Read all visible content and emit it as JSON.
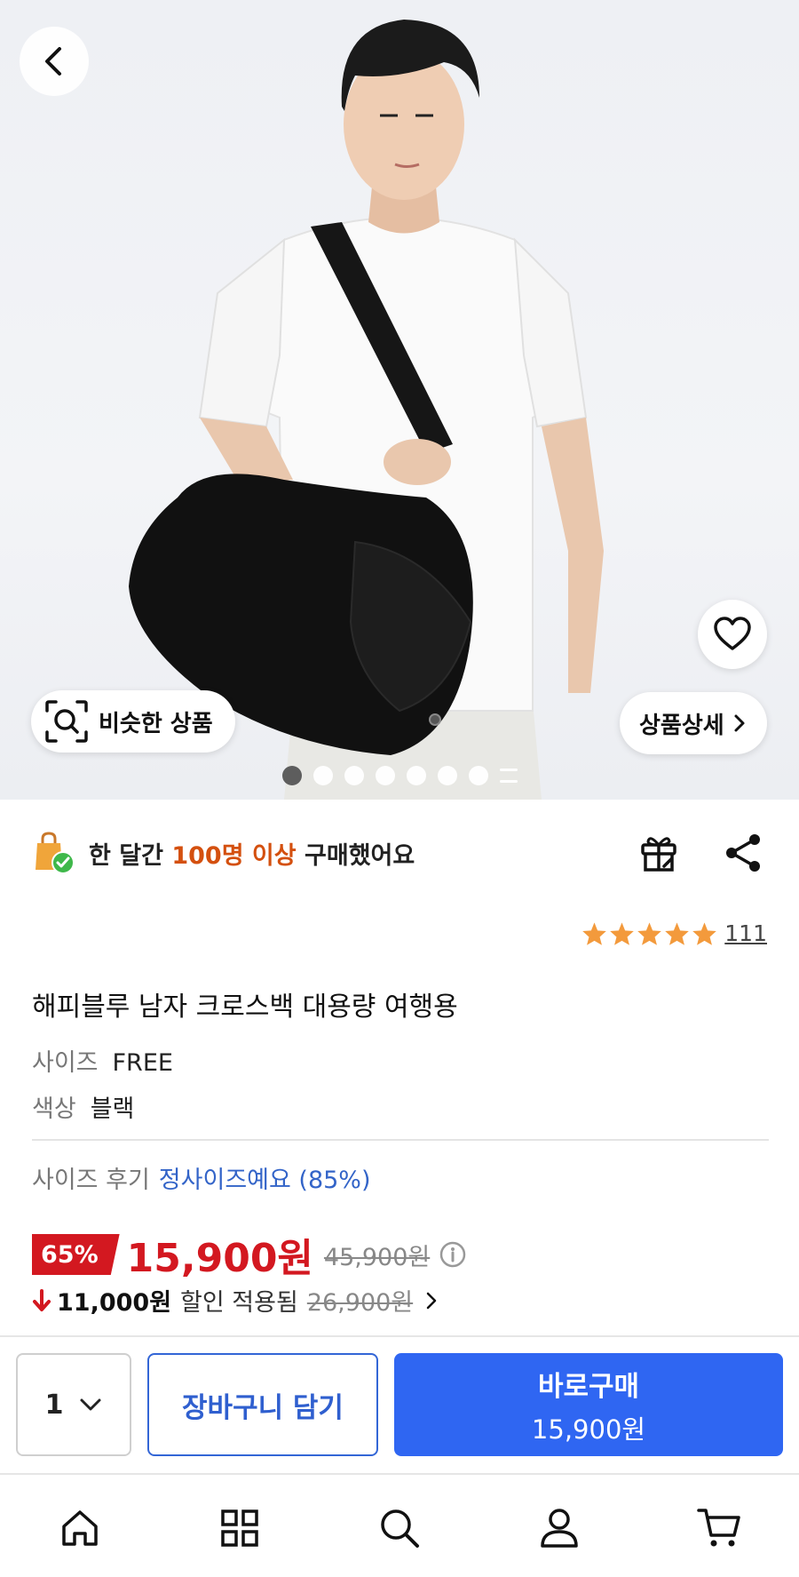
{
  "hero": {
    "similar_label": "비슷한 상품",
    "detail_label": "상품상세",
    "total_images": 7,
    "active_image": 1
  },
  "social_proof": {
    "prefix": "한 달간 ",
    "highlight": "100명 이상",
    "suffix": " 구매했어요",
    "highlight_color": "#d4500f"
  },
  "rating": {
    "stars": 5,
    "count": "111"
  },
  "product": {
    "title": "해피블루 남자 크로스백 대용량 여행용",
    "size_key": "사이즈",
    "size_value": "FREE",
    "color_key": "색상",
    "color_value": "블랙",
    "review_key": "사이즈 후기",
    "review_value": "정사이즈예요 (85%)"
  },
  "price": {
    "discount_rate": "65%",
    "sale_price": "15,900원",
    "original_price": "45,900원",
    "coupon_amount": "11,000원",
    "coupon_text": "할인 적용됨",
    "pre_coupon_price": "26,900원",
    "accent_color": "#d31820"
  },
  "actions": {
    "quantity": "1",
    "cart_label": "장바구니 담기",
    "buy_label": "바로구매",
    "buy_price": "15,900원",
    "primary_color": "#2f66f2"
  },
  "nav": {
    "items": [
      "home-icon",
      "category-grid-icon",
      "search-icon",
      "my-page-icon",
      "cart-icon"
    ]
  }
}
